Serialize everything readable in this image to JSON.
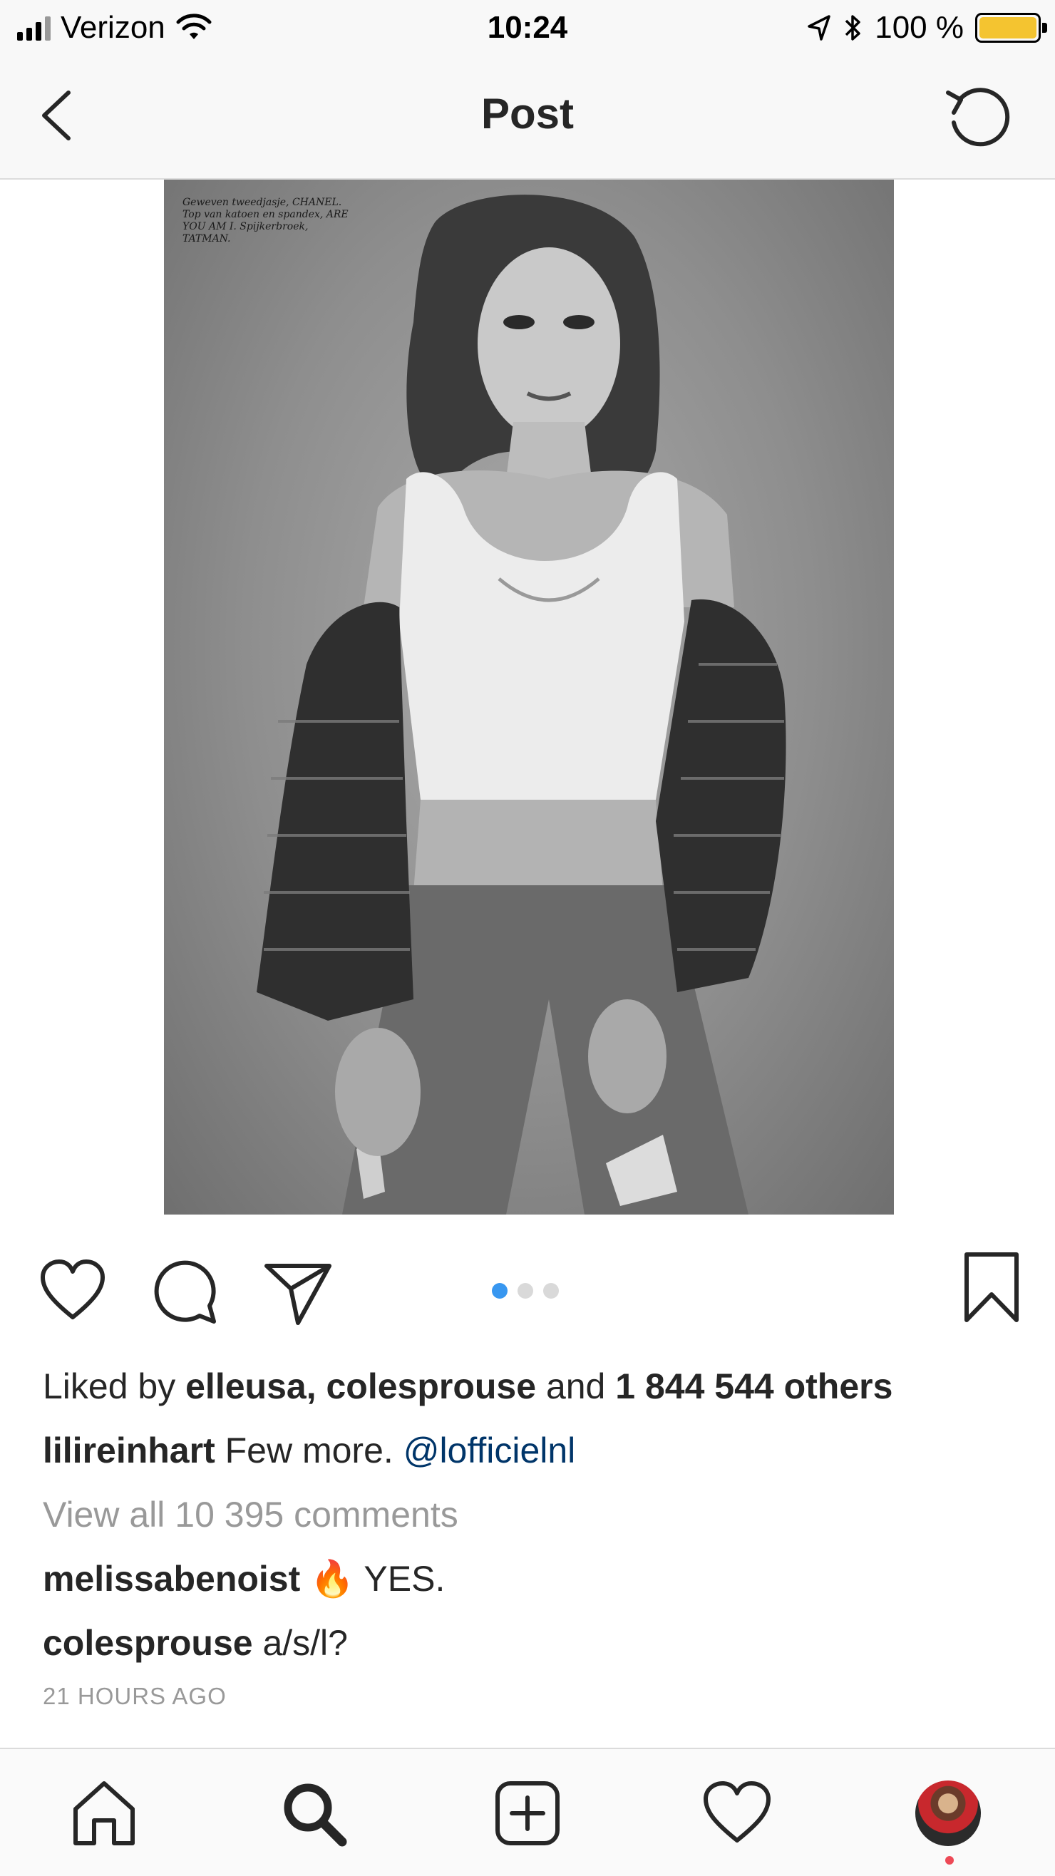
{
  "status_bar": {
    "carrier": "Verizon",
    "time": "10:24",
    "battery": "100 %",
    "battery_level": 1.0,
    "battery_color": "#f4c430"
  },
  "nav": {
    "title": "Post",
    "back_icon": "chevron-left-icon",
    "refresh_icon": "refresh-icon"
  },
  "post": {
    "image_caption": "Geweven tweedjasje, CHANEL. Top van katoen en spandex, ARE YOU AM I. Spijkerbroek, TATMAN.",
    "carousel": {
      "count": 3,
      "active_index": 0,
      "active_color": "#3897f0"
    },
    "likes": {
      "prefix": "Liked by ",
      "user1": "elleusa",
      "separator": ", ",
      "user2": "colesprouse",
      "conjunction": " and ",
      "others": "1 844 544 others"
    },
    "caption": {
      "username": "lilireinhart",
      "text": " Few more. ",
      "mention": "@lofficielnl"
    },
    "view_comments": "View all 10 395 comments",
    "comments": [
      {
        "username": "melissabenoist",
        "text": " 🔥 YES."
      },
      {
        "username": "colesprouse",
        "text": " a/s/l?"
      }
    ],
    "timestamp": "21 HOURS AGO"
  },
  "tabs": [
    "home-icon",
    "search-icon",
    "new-post-icon",
    "activity-icon",
    "profile-avatar"
  ],
  "colors": {
    "link": "#003569",
    "muted": "#999999",
    "notification": "#ed4956"
  }
}
